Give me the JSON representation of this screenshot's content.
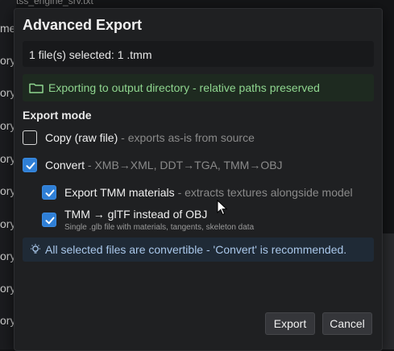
{
  "background": {
    "top_text": "tss_engine_srv.txt",
    "items": [
      "ory",
      "ory",
      "ory",
      "ory",
      "ory",
      "ory",
      "ory",
      "ory",
      "ory",
      "ory"
    ]
  },
  "dialog": {
    "title": "Advanced Export",
    "selected_summary": "1 file(s) selected: 1 .tmm",
    "info_message": "Exporting to output directory - relative paths preserved",
    "section_label": "Export mode",
    "options": {
      "copy": {
        "label": "Copy (raw file)",
        "hint": "- exports as-is from source",
        "checked": false
      },
      "convert": {
        "label": "Convert",
        "hint": "- XMB→XML, DDT→TGA, TMM→OBJ",
        "checked": true
      },
      "export_tmm_materials": {
        "label": "Export TMM materials",
        "hint": "- extracts textures alongside model",
        "checked": true
      },
      "tmm_gltf": {
        "label": "TMM → glTF instead of OBJ",
        "sub": "Single .glb file with materials, tangents, skeleton data",
        "checked": true
      }
    },
    "tip": "All selected files are convertible - 'Convert' is recommended.",
    "buttons": {
      "export": "Export",
      "cancel": "Cancel"
    }
  },
  "colors": {
    "accent": "#2f7fd6",
    "success_text": "#8fd68f",
    "info_text": "#a9c7ea",
    "hint_text": "#8a8a8a"
  },
  "icons": [
    "folder-icon",
    "checkmark-icon",
    "lightbulb-icon",
    "mouse-cursor-icon"
  ]
}
